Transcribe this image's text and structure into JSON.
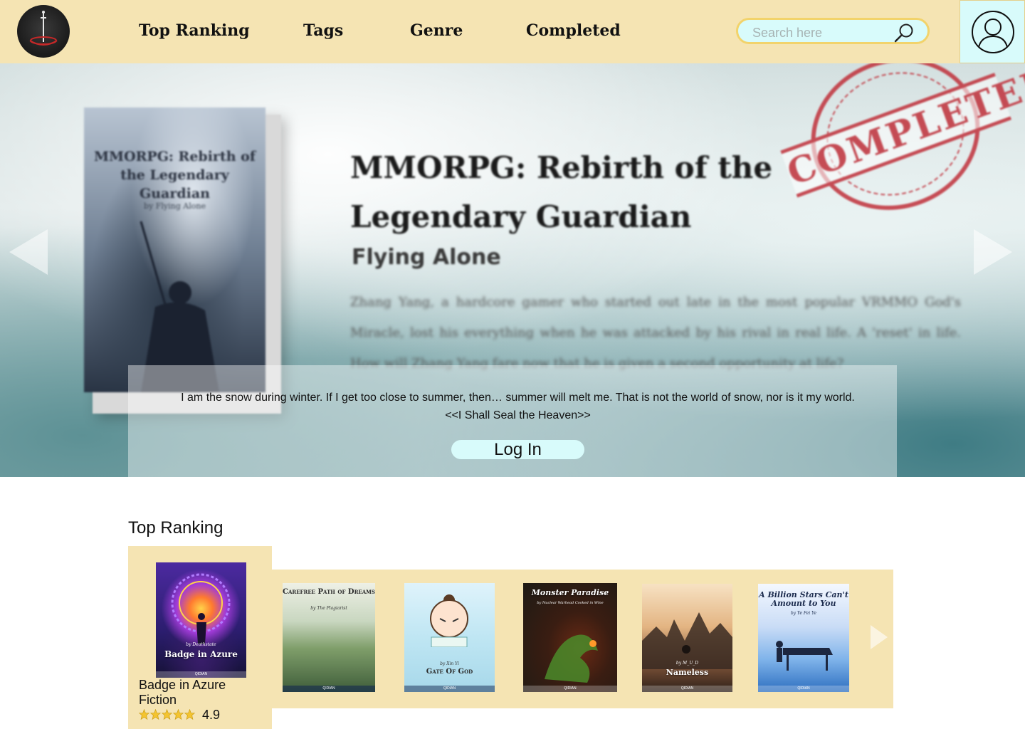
{
  "nav": {
    "links": [
      "Top Ranking",
      "Tags",
      "Genre",
      "Completed"
    ]
  },
  "search": {
    "placeholder": "Search here"
  },
  "hero": {
    "title": "MMORPG: Rebirth of the Legendary Guardian",
    "author": "Flying Alone",
    "synopsis": "Zhang Yang, a hardcore gamer who started out late in the most popular VRMMO God's Miracle, lost his everything when he was attacked by his rival in real life. A 'reset' in life. How will Zhang Yang fare now that he is given a second opportunity at life?",
    "stamp": "COMPLETED",
    "book_cover_title": "MMORPG: Rebirth of the Legendary Guardian",
    "book_cover_author": "by Flying Alone",
    "quote_line1": "I am the snow during winter. If I get too close to summer, then… summer will melt me. That is not the world of snow, nor is it my world.",
    "quote_line2": "<<I Shall Seal the Heaven>>",
    "login_label": "Log In"
  },
  "ranking": {
    "section_title": "Top Ranking",
    "featured": {
      "cover_title": "Badge in Azure",
      "cover_author": "by Deathstate",
      "cover_publisher": "QIDIAN",
      "title": "Badge in Azure",
      "genre": "Fiction",
      "rating": "4.9",
      "stars": 5
    },
    "books": [
      {
        "title": "Carefree Path of Dreams",
        "author": "by The Plagiarist",
        "publisher": "QIDIAN"
      },
      {
        "title": "Gate Of God",
        "author": "by Xin Yi",
        "publisher": "QIDIAN"
      },
      {
        "title": "Monster Paradise",
        "author": "by Nuclear Warhead Cooked in Wine",
        "publisher": "QIDIAN"
      },
      {
        "title": "Nameless",
        "author": "by M_U_D",
        "publisher": "QIDIAN"
      },
      {
        "title": "A Billion Stars Can't Amount to You",
        "author": "by Ye Fei Ye",
        "publisher": "QIDIAN"
      }
    ]
  },
  "colors": {
    "header_bg": "#f5e4b3",
    "accent_cyan": "#d8fbfb",
    "search_border": "#f2d36b",
    "star": "#f4c430",
    "stamp_red": "#c0303a"
  },
  "icons": {
    "logo": "sword-logo-icon",
    "search": "search-icon",
    "profile": "user-icon",
    "prev": "triangle-left-icon",
    "next": "triangle-right-icon",
    "star": "star-icon"
  }
}
